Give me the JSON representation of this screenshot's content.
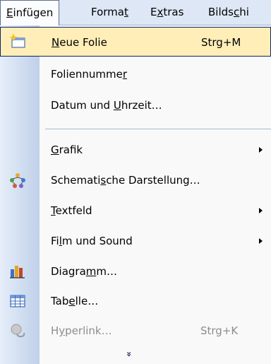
{
  "menubar": {
    "items": [
      {
        "pre": "E",
        "acc": "",
        "post": "infügen",
        "ul": "E"
      },
      {
        "pre": "Forma",
        "acc": "t",
        "post": ""
      },
      {
        "pre": "E",
        "acc": "x",
        "post": "tras"
      },
      {
        "pre": "Bilds",
        "acc": "c",
        "post": "hi"
      }
    ]
  },
  "menu": {
    "items": [
      {
        "pre": "",
        "acc": "N",
        "post": "eue Folie",
        "shortcut": "Strg+M"
      },
      {
        "pre": "Foliennumme",
        "acc": "r",
        "post": ""
      },
      {
        "pre": "Datum und ",
        "acc": "U",
        "post": "hrzeit…"
      },
      {
        "pre": "",
        "acc": "G",
        "post": "rafik"
      },
      {
        "pre": "Schemati",
        "acc": "s",
        "post": "che Darstellung…"
      },
      {
        "pre": "",
        "acc": "T",
        "post": "extfeld"
      },
      {
        "pre": "Fi",
        "acc": "l",
        "post": "m und Sound"
      },
      {
        "pre": "Diagra",
        "acc": "m",
        "post": "m…"
      },
      {
        "pre": "Tab",
        "acc": "e",
        "post": "lle…"
      },
      {
        "pre": "H",
        "acc": "y",
        "post": "perlink…",
        "shortcut": "Strg+K"
      }
    ]
  },
  "expand_glyph": "»"
}
